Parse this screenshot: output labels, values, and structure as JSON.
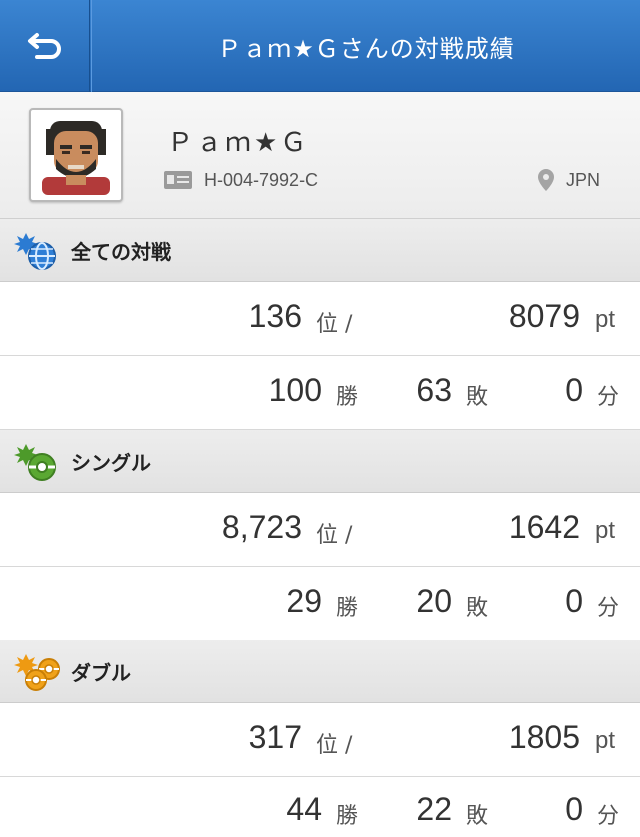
{
  "header": {
    "title": "Ｐａｍ★Ｇさんの対戦成績",
    "back_icon": "back-arrow-icon"
  },
  "profile": {
    "name": "Ｐａｍ★Ｇ",
    "trainer_id": "H-004-7992-C",
    "country": "JPN"
  },
  "sections": [
    {
      "title": "全ての対戦",
      "icon": "globe-icon",
      "rank": "136",
      "rank_unit": "位 /",
      "points": "8079",
      "points_unit": "pt",
      "wins": "100",
      "wins_unit": "勝",
      "losses": "63",
      "losses_unit": "敗",
      "draws": "0",
      "draws_unit": "分"
    },
    {
      "title": "シングル",
      "icon": "single-ball-icon",
      "rank": "8,723",
      "rank_unit": "位 /",
      "points": "1642",
      "points_unit": "pt",
      "wins": "29",
      "wins_unit": "勝",
      "losses": "20",
      "losses_unit": "敗",
      "draws": "0",
      "draws_unit": "分"
    },
    {
      "title": "ダブル",
      "icon": "double-ball-icon",
      "rank": "317",
      "rank_unit": "位 /",
      "points": "1805",
      "points_unit": "pt",
      "wins": "44",
      "wins_unit": "勝",
      "losses": "22",
      "losses_unit": "敗",
      "draws": "0",
      "draws_unit": "分"
    }
  ],
  "colors": {
    "header_blue": "#2c74c4",
    "single_green": "#5aa832",
    "double_orange": "#f0a21a",
    "globe_blue": "#2f7fd6"
  }
}
